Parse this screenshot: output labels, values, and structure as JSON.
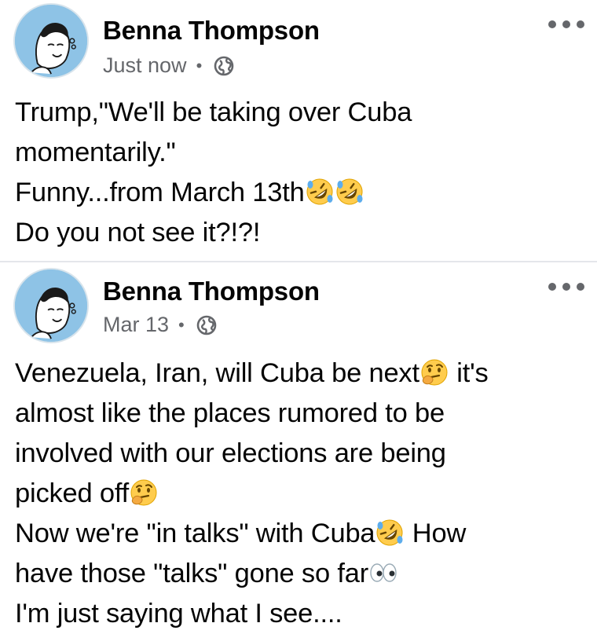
{
  "posts": [
    {
      "avatar_text": "COULD'VE GOTCHA",
      "author": "Benna Thompson",
      "timestamp": "Just now",
      "separator": "•",
      "audience_icon": "globe-icon",
      "menu_icon": "more-options-icon",
      "lines": [
        {
          "text": "Trump,\"We'll be taking over Cuba"
        },
        {
          "text": "momentarily.\""
        },
        {
          "text": "Funny...from March 13th",
          "emoji_after": [
            "rofl-emoji",
            "rofl-emoji"
          ]
        },
        {
          "text": "Do you not see it?!?!"
        }
      ]
    },
    {
      "avatar_text": "COULD'VE GOTCHA",
      "author": "Benna Thompson",
      "timestamp": "Mar 13",
      "separator": "•",
      "audience_icon": "globe-icon",
      "menu_icon": "more-options-icon",
      "lines": [
        {
          "text_a": "Venezuela, Iran, will Cuba be next",
          "emoji": "thinking-emoji",
          "text_b": " it's"
        },
        {
          "text": "almost like the places rumored to be"
        },
        {
          "text": "involved with our elections are being"
        },
        {
          "text": "picked off",
          "emoji_after": [
            "thinking-emoji"
          ]
        },
        {
          "text_a": "Now we're \"in talks\" with Cuba",
          "emoji": "rofl-emoji",
          "text_b": " How"
        },
        {
          "text": "have those \"talks\" gone so far",
          "emoji_after": [
            "eyes-emoji"
          ]
        },
        {
          "text": "I'm just saying what I see...."
        }
      ]
    }
  ],
  "colors": {
    "text": "#050505",
    "secondary_text": "#65676b",
    "avatar_bg": "#8ec3e6",
    "emoji_yellow": "#ffcc4d"
  }
}
